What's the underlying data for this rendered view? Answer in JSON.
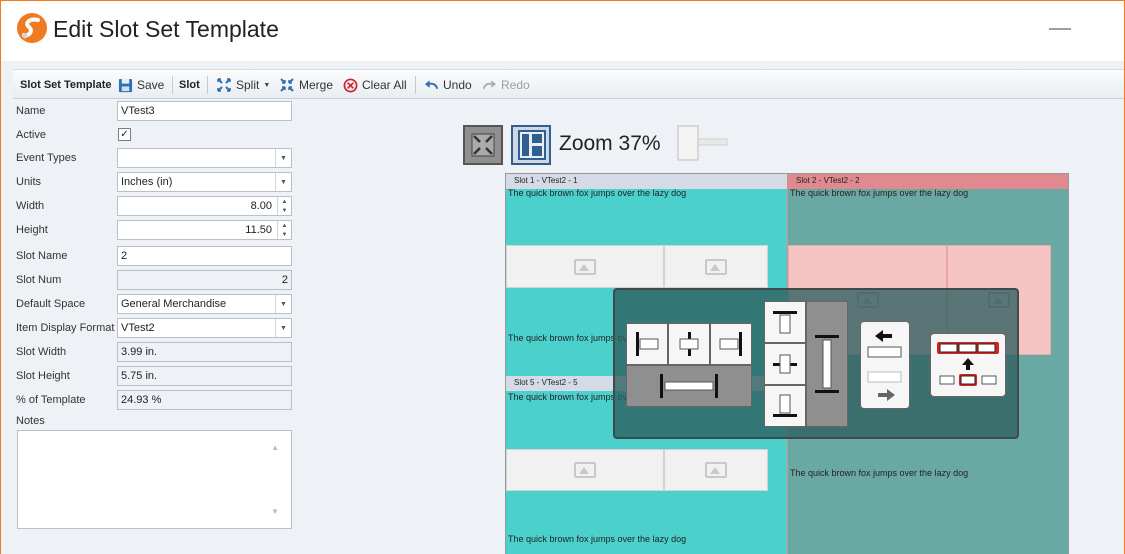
{
  "window": {
    "title": "Edit Slot Set Template",
    "accent_color": "#f07a22"
  },
  "toolbar": {
    "group1": "Slot Set Template",
    "save": "Save",
    "group2": "Slot",
    "split": "Split",
    "merge": "Merge",
    "clear_all": "Clear All",
    "undo": "Undo",
    "redo": "Redo"
  },
  "form": {
    "name": {
      "label": "Name",
      "value": "VTest3"
    },
    "active": {
      "label": "Active",
      "checked": true,
      "mark": "✓"
    },
    "event_types": {
      "label": "Event Types",
      "value": ""
    },
    "units": {
      "label": "Units",
      "value": "Inches (in)"
    },
    "width": {
      "label": "Width",
      "value": "8.00"
    },
    "height": {
      "label": "Height",
      "value": "11.50"
    },
    "slot_name": {
      "label": "Slot Name",
      "value": "2"
    },
    "slot_num": {
      "label": "Slot Num",
      "value": "2"
    },
    "default_space": {
      "label": "Default Space",
      "value": "General Merchandise"
    },
    "item_display_format": {
      "label": "Item Display Format",
      "value": "VTest2"
    },
    "slot_width": {
      "label": "Slot Width",
      "value": "3.99 in."
    },
    "slot_height": {
      "label": "Slot Height",
      "value": "5.75 in."
    },
    "percent_of_template": {
      "label": "% of Template",
      "value": "24.93 %"
    },
    "notes": {
      "label": "Notes",
      "value": ""
    }
  },
  "zoom": {
    "label": "Zoom 37%"
  },
  "canvas": {
    "slots": [
      {
        "header": "Slot 1 - VTest2 - 1",
        "text": "The quick brown fox jumps over the lazy dog",
        "bg": "#4bd0cc"
      },
      {
        "header": "Slot 2 - VTest2 - 2",
        "text": "The quick brown fox jumps over the lazy dog",
        "bg": "#6aa9a3",
        "selected": true
      },
      {
        "header": "Slot 5 - VTest2 - 5",
        "text": "The quick brown fox jumps over the lazy dog",
        "bg": "#4bd0cc"
      }
    ],
    "middle_text_left": "The quick brown fox jumps over the lazy dog",
    "bottom_text_left": "The quick brown fox jumps over the lazy dog",
    "bottom_text_right": "The quick brown fox jumps over the lazy dog",
    "selection_color": "#e08a8f"
  },
  "icons": {
    "logo": "app-logo-icon",
    "save": "floppy-disk-icon",
    "split": "split-arrows-icon",
    "merge": "merge-arrows-icon",
    "clear": "clear-circle-x-icon",
    "undo": "undo-arrow-icon",
    "redo": "redo-arrow-icon"
  }
}
